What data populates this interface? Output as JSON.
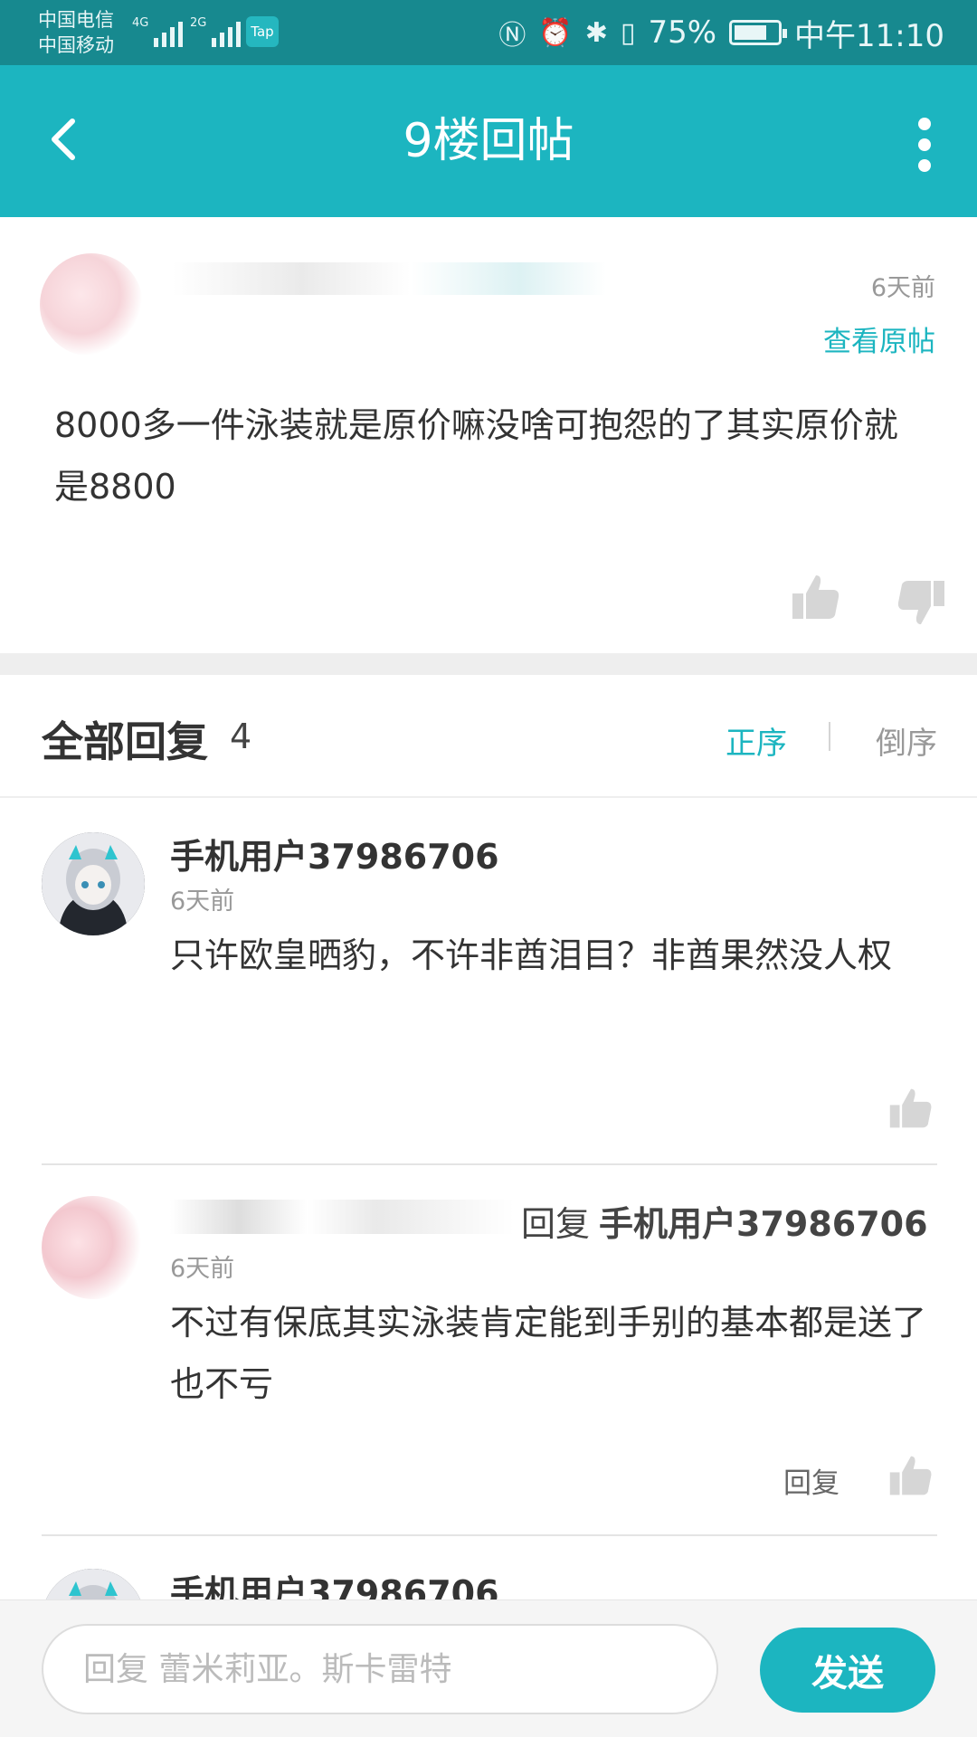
{
  "status_bar": {
    "carrier_1": "中国电信",
    "carrier_2": "中国移动",
    "net_1": "4G",
    "net_2": "2G",
    "tap_badge": "Tap",
    "battery_percent": "75%",
    "battery_level": 0.75,
    "time": "中午11:10"
  },
  "header": {
    "title": "9楼回帖"
  },
  "post": {
    "time": "6天前",
    "view_original": "查看原帖",
    "content": "8000多一件泳装就是原价嘛没啥可抱怨的了其实原价就是8800"
  },
  "replies": {
    "title": "全部回复",
    "count": "4",
    "sort_asc": "正序",
    "sort_desc": "倒序",
    "items": [
      {
        "name": "手机用户37986706",
        "time": "6天前",
        "content": "只许欧皇晒豹，不许非酋泪目？非酋果然没人权"
      },
      {
        "reply_verb": "回复",
        "reply_target": "手机用户37986706",
        "time": "6天前",
        "content": "不过有保底其实泳装肯定能到手别的基本都是送了也不亏",
        "action": "回复"
      },
      {
        "name": "手机用户37986706"
      }
    ]
  },
  "input_bar": {
    "placeholder": "回复 蕾米莉亚。斯卡雷特",
    "send_label": "发送"
  },
  "colors": {
    "accent": "#1cb5c0",
    "status_bar": "#17898f"
  },
  "icons": {
    "back": "chevron-left-icon",
    "more": "more-vertical-icon",
    "like": "thumbs-up-icon",
    "dislike": "thumbs-down-icon"
  }
}
